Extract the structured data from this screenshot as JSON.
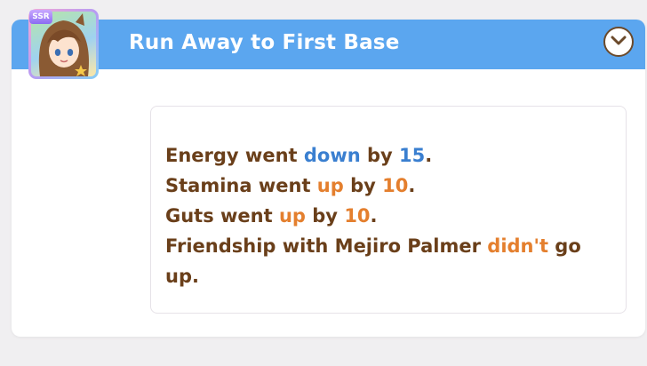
{
  "event": {
    "title": "Run Away to First Base",
    "rarity_badge": "SSR",
    "lines": [
      [
        {
          "t": "Energy went ",
          "k": "plain"
        },
        {
          "t": "down",
          "k": "down"
        },
        {
          "t": " by ",
          "k": "plain"
        },
        {
          "t": "15",
          "k": "down"
        },
        {
          "t": ".",
          "k": "plain"
        }
      ],
      [
        {
          "t": "Stamina went ",
          "k": "plain"
        },
        {
          "t": "up",
          "k": "up"
        },
        {
          "t": " by ",
          "k": "plain"
        },
        {
          "t": "10",
          "k": "up"
        },
        {
          "t": ".",
          "k": "plain"
        }
      ],
      [
        {
          "t": "Guts went ",
          "k": "plain"
        },
        {
          "t": "up",
          "k": "up"
        },
        {
          "t": " by ",
          "k": "plain"
        },
        {
          "t": "10",
          "k": "up"
        },
        {
          "t": ".",
          "k": "plain"
        }
      ],
      [
        {
          "t": "Friendship with Mejiro Palmer ",
          "k": "plain"
        },
        {
          "t": "didn't",
          "k": "up"
        },
        {
          "t": " go up.",
          "k": "plain"
        }
      ]
    ]
  },
  "icons": {
    "toggle": "chevron-down-icon",
    "avatar": "character-portrait-icon"
  },
  "colors": {
    "header": "#5ba6ef",
    "text": "#6a3f1a",
    "decrease": "#3a7fd0",
    "increase": "#e47f2e"
  }
}
